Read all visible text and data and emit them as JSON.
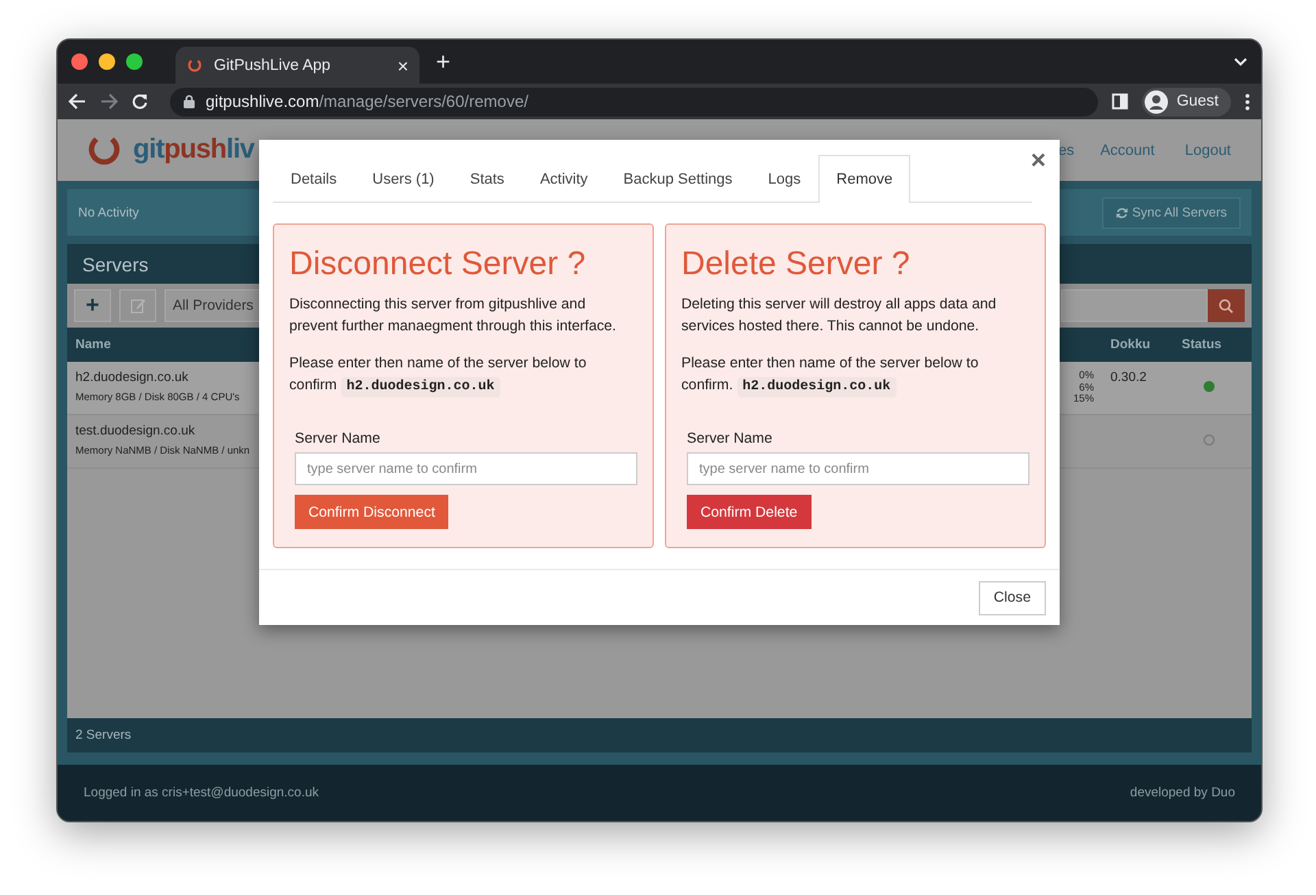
{
  "browser": {
    "tab": {
      "title": "GitPushLive App",
      "close": "×"
    },
    "new_tab": "+",
    "url_host": "gitpushlive.com",
    "url_path": "/manage/servers/60/remove/",
    "forward_disabled": true,
    "profile": "Guest"
  },
  "app": {
    "logo": [
      "git",
      "push",
      "liv"
    ],
    "nav": [
      "es",
      "Account",
      "Logout"
    ],
    "activity": "No Activity",
    "sync_button": "Sync All Servers",
    "servers": {
      "title": "Servers",
      "add": "+",
      "provider_filter": "All Providers",
      "columns": [
        "Name",
        "Dokku",
        "Status"
      ],
      "rows": [
        {
          "name": "h2.duodesign.co.uk",
          "specs": "Memory 8GB / Disk 80GB / 4 CPU's",
          "usage": [
            "0%",
            "6%",
            "15%"
          ],
          "dokku": "0.30.2",
          "online": true
        },
        {
          "name": "test.duodesign.co.uk",
          "specs": "Memory NaNMB / Disk NaNMB / unkn",
          "online": false
        }
      ],
      "count": "2 Servers"
    },
    "footer": {
      "logged_in": "Logged in as cris+test@duodesign.co.uk",
      "credit": "developed by Duo"
    }
  },
  "modal": {
    "tabs": [
      {
        "label": "Details",
        "selected": false
      },
      {
        "label": "Users (1)",
        "selected": false
      },
      {
        "label": "Stats",
        "selected": false
      },
      {
        "label": "Activity",
        "selected": false
      },
      {
        "label": "Backup Settings",
        "selected": false
      },
      {
        "label": "Logs",
        "selected": false
      },
      {
        "label": "Remove",
        "selected": true
      }
    ],
    "close": "×",
    "cards": [
      {
        "kind": "disconnect",
        "title": "Disconnect Server ?",
        "description": "Disconnecting this server from gitpushlive and prevent further manaegment through this interface.",
        "prompt": "Please enter then name of the server below to confirm",
        "server": "h2.duodesign.co.uk",
        "field_label": "Server Name",
        "placeholder": "type server name to confirm",
        "button": "Confirm Disconnect"
      },
      {
        "kind": "delete",
        "title": "Delete Server ?",
        "description": "Deleting this server will destroy all apps data and services hosted there. This cannot be undone.",
        "prompt": "Please enter then name of the server below to confirm.",
        "server": "h2.duodesign.co.uk",
        "field_label": "Server Name",
        "placeholder": "type server name to confirm",
        "button": "Confirm Delete"
      }
    ],
    "footer_button": "Close"
  }
}
